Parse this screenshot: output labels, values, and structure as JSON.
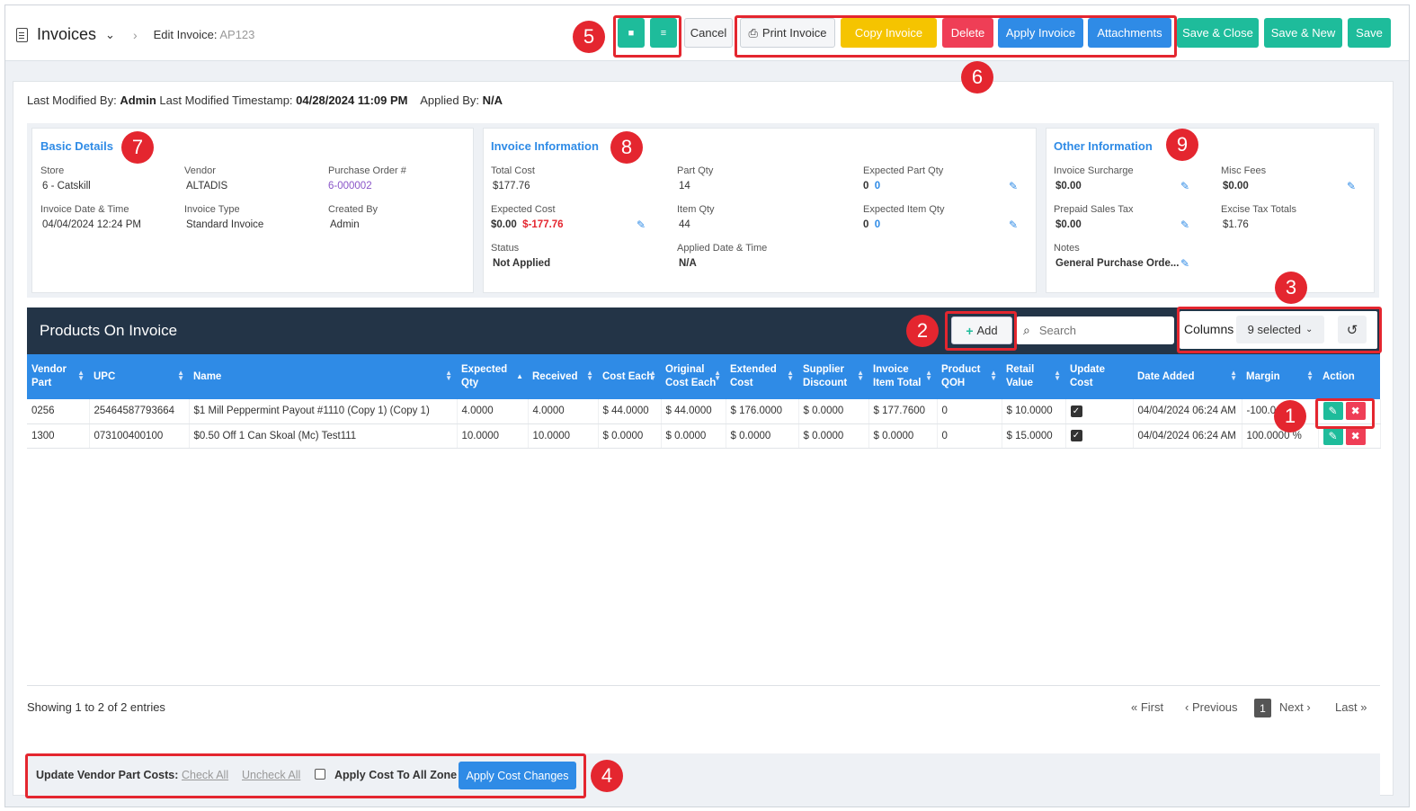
{
  "header": {
    "module": "Invoices",
    "crumb_label": "Edit Invoice:",
    "crumb_id": "AP123",
    "buttons": {
      "cancel": "Cancel",
      "print": "Print Invoice",
      "copy": "Copy Invoice",
      "delete": "Delete",
      "apply": "Apply Invoice",
      "attachments": "Attachments",
      "save_close": "Save & Close",
      "save_new": "Save & New",
      "save": "Save"
    }
  },
  "meta": {
    "modified_by_label": "Last Modified By:",
    "modified_by": "Admin",
    "timestamp_label": "Last Modified Timestamp:",
    "timestamp": "04/28/2024 11:09 PM",
    "applied_by_label": "Applied By:",
    "applied_by": "N/A"
  },
  "basic": {
    "title": "Basic Details",
    "store_label": "Store",
    "store": "6 - Catskill",
    "vendor_label": "Vendor",
    "vendor": "ALTADIS",
    "po_label": "Purchase Order #",
    "po": "6-000002",
    "date_label": "Invoice Date & Time",
    "date": "04/04/2024 12:24 PM",
    "type_label": "Invoice Type",
    "type": "Standard Invoice",
    "created_label": "Created By",
    "created": "Admin"
  },
  "invoice": {
    "title": "Invoice Information",
    "total_cost_label": "Total Cost",
    "total_cost": "$177.76",
    "part_qty_label": "Part Qty",
    "part_qty": "14",
    "exp_part_label": "Expected Part Qty",
    "exp_part_a": "0",
    "exp_part_b": "0",
    "exp_cost_label": "Expected Cost",
    "exp_cost": "$0.00",
    "exp_cost_diff": "$-177.76",
    "item_qty_label": "Item Qty",
    "item_qty": "44",
    "exp_item_label": "Expected Item Qty",
    "exp_item_a": "0",
    "exp_item_b": "0",
    "status_label": "Status",
    "status": "Not Applied",
    "applied_label": "Applied Date & Time",
    "applied": "N/A"
  },
  "other": {
    "title": "Other Information",
    "surcharge_label": "Invoice Surcharge",
    "surcharge": "$0.00",
    "misc_label": "Misc Fees",
    "misc": "$0.00",
    "prepaid_label": "Prepaid Sales Tax",
    "prepaid": "$0.00",
    "excise_label": "Excise Tax Totals",
    "excise": "$1.76",
    "notes_label": "Notes",
    "notes": "General Purchase Orde..."
  },
  "products": {
    "title": "Products On Invoice",
    "add_label": "Add",
    "search_placeholder": "Search",
    "columns_label": "Columns",
    "columns_selected": "9 selected",
    "headers": [
      "Vendor Part",
      "UPC",
      "Name",
      "Expected Qty",
      "Received",
      "Cost Each",
      "Original Cost Each",
      "Extended Cost",
      "Supplier Discount",
      "Invoice Item Total",
      "Product QOH",
      "Retail Value",
      "Update Cost",
      "Date Added",
      "Margin",
      "Action"
    ],
    "rows": [
      [
        "0256",
        "25464587793664",
        "$1 Mill Peppermint Payout #1110 (Copy 1) (Copy 1)",
        "4.0000",
        "4.0000",
        "$ 44.0000",
        "$ 44.0000",
        "$ 176.0000",
        "$ 0.0000",
        "$ 177.7600",
        "0",
        "$ 10.0000",
        "",
        "04/04/2024 06:24 AM",
        "-100.0"
      ],
      [
        "1300",
        "073100400100",
        "$0.50 Off 1 Can Skoal (Mc) Test111",
        "10.0000",
        "10.0000",
        "$ 0.0000",
        "$ 0.0000",
        "$ 0.0000",
        "$ 0.0000",
        "$ 0.0000",
        "0",
        "$ 15.0000",
        "",
        "04/04/2024 06:24 AM",
        "100.0000 %"
      ]
    ]
  },
  "pagination": {
    "showing": "Showing 1 to 2 of 2 entries",
    "first": "First",
    "previous": "Previous",
    "page": "1",
    "next": "Next",
    "last": "Last"
  },
  "footer": {
    "label": "Update Vendor Part Costs:",
    "check_all": "Check All",
    "uncheck_all": "Uncheck All",
    "apply_zone": "Apply Cost To All Zone",
    "apply_btn": "Apply Cost Changes"
  },
  "callouts": [
    "1",
    "2",
    "3",
    "4",
    "5",
    "6",
    "7",
    "8",
    "9"
  ],
  "colors": {
    "teal": "#1ebc9b",
    "blue": "#2f8be6",
    "red": "#ef3e56",
    "yellow": "#f5c400",
    "navy": "#233447",
    "callout": "#e4262f"
  }
}
